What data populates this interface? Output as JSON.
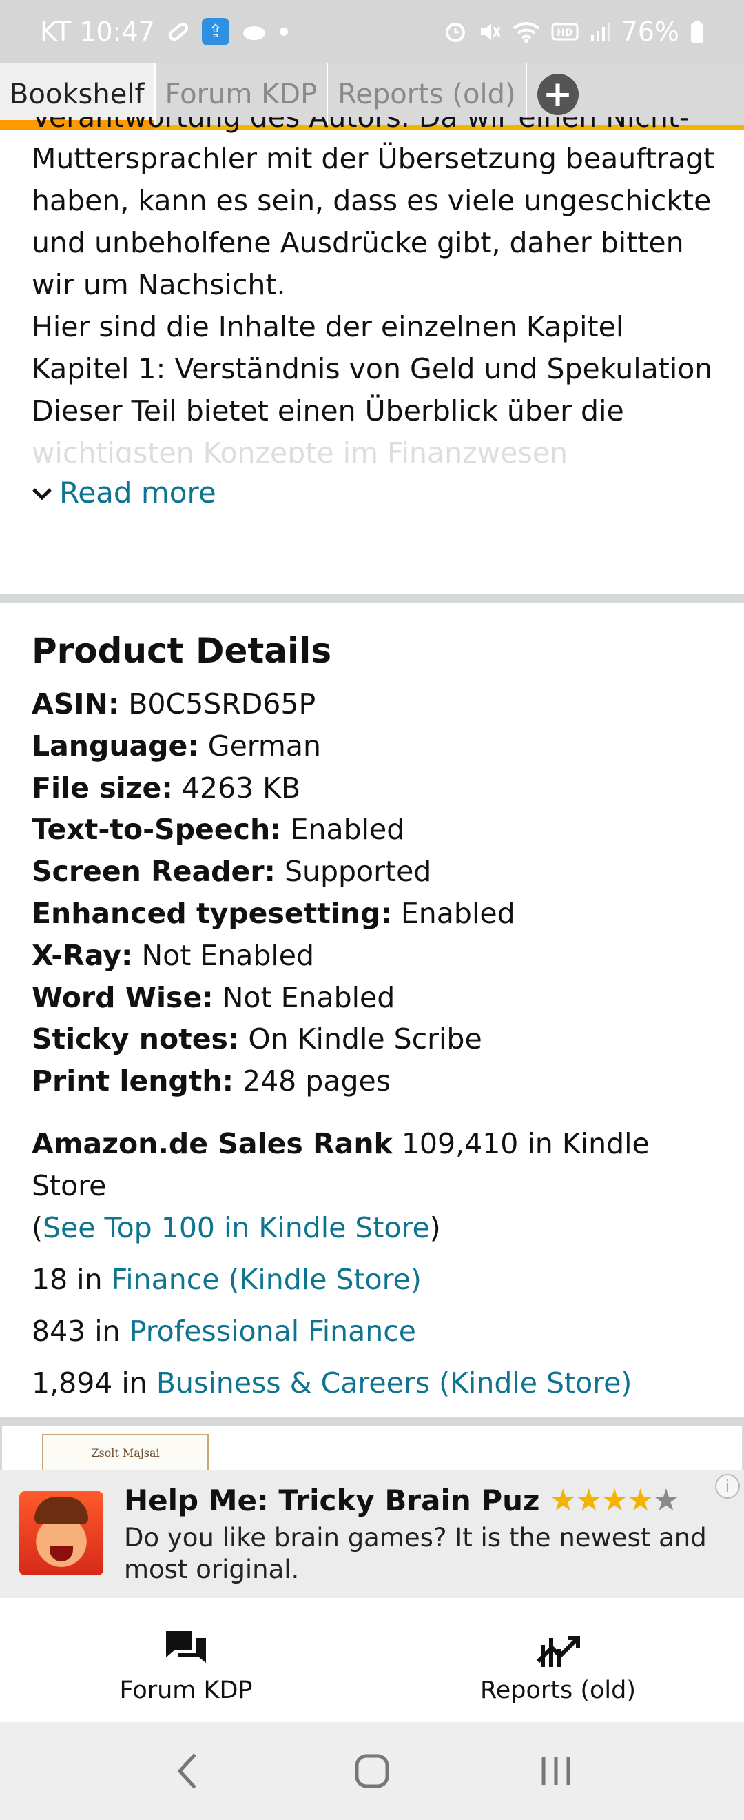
{
  "status_bar": {
    "carrier_time": "KT 10:47",
    "battery": "76%"
  },
  "tabs": [
    {
      "label": "Bookshelf",
      "active": true
    },
    {
      "label": "Forum KDP",
      "active": false
    },
    {
      "label": "Reports (old)",
      "active": false
    }
  ],
  "description": {
    "lines": [
      "Verantwortung des Autors. Da wir einen Nicht-",
      "Muttersprachler mit der Übersetzung beauftragt",
      "haben, kann es sein, dass es viele ungeschickte",
      "und unbeholfene Ausdrücke gibt, daher bitten",
      "wir um Nachsicht.",
      "Hier sind die Inhalte der einzelnen Kapitel",
      "Kapitel 1: Verständnis von Geld und Spekulation",
      "Dieser Teil bietet einen Überblick über die",
      "wichtigsten Konzepte im Finanzwesen"
    ],
    "read_more": "Read more"
  },
  "product_details": {
    "heading": "Product Details",
    "rows": [
      {
        "label": "ASIN:",
        "value": "B0C5SRD65P"
      },
      {
        "label": "Language:",
        "value": "German"
      },
      {
        "label": "File size:",
        "value": "4263 KB"
      },
      {
        "label": "Text-to-Speech:",
        "value": "Enabled"
      },
      {
        "label": "Screen Reader:",
        "value": "Supported"
      },
      {
        "label": "Enhanced typesetting:",
        "value": "Enabled"
      },
      {
        "label": "X-Ray:",
        "value": "Not Enabled"
      },
      {
        "label": "Word Wise:",
        "value": "Not Enabled"
      },
      {
        "label": "Sticky notes:",
        "value": "On Kindle Scribe"
      },
      {
        "label": "Print length:",
        "value": "248 pages"
      }
    ],
    "sales_rank": {
      "label": "Amazon.de Sales Rank",
      "value": "109,410 in Kindle Store",
      "open_paren": "(",
      "link": "See Top 100 in Kindle Store",
      "close_paren": ")"
    },
    "category_ranks": [
      {
        "rank": "18 in",
        "category": "Finance (Kindle Store)"
      },
      {
        "rank": "843 in",
        "category": "Professional Finance"
      },
      {
        "rank": "1,894 in",
        "category": "Business & Careers (Kindle Store)"
      }
    ]
  },
  "book_peek": {
    "author": "Zsolt Majsai"
  },
  "ad": {
    "title": "Help Me: Tricky Brain Puz",
    "rating_stars": 4,
    "rating_max": 5,
    "text": "Do you like brain games? It is the newest and most original.",
    "info_icon": "info-icon"
  },
  "bottom_nav": [
    {
      "label": "Forum KDP",
      "icon": "forum-icon"
    },
    {
      "label": "Reports (old)",
      "icon": "chart-trend-icon"
    }
  ],
  "colors": {
    "link": "#0e7490",
    "tab_accent": "#ff9900",
    "star": "#f5b301"
  }
}
